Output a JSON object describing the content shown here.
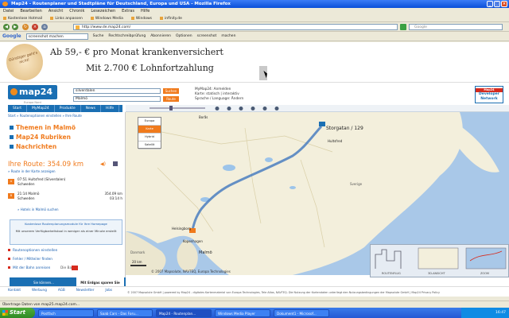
{
  "window": {
    "title": "Map24 - Routenplaner und Stadtpläne für Deutschland, Europa und USA - Mozilla Firefox"
  },
  "menu": [
    "Datei",
    "Bearbeiten",
    "Ansicht",
    "Chronik",
    "Lesezeichen",
    "Extras",
    "Hilfe"
  ],
  "bookmarks": [
    "Kostenlose Hotmail",
    "Links anpassen",
    "Windows Media",
    "Windows",
    "infinity.de"
  ],
  "nav": {
    "url": "http://www.de.map24.com/",
    "search_placeholder": "Google"
  },
  "google_toolbar": {
    "logo": "Google",
    "query": "screenshot machen",
    "items": [
      "Suche",
      "Rechtschreibprüfung",
      "Abonnieren",
      "Optionen",
      "screenshot",
      "machen"
    ]
  },
  "ad": {
    "stamp": "Günstiger geht's nicht!",
    "line1": "Ab 59,- € pro Monat krankenversichert",
    "line2": "Mit 2.700 € Lohnfortzahlung"
  },
  "header": {
    "logo": "map24",
    "logo_sub": "Europa Nord",
    "from": "silverdalen",
    "to": "Malmö",
    "route_btn": "Route",
    "search_btn": "Suchen",
    "links": [
      "MyMap24: Anmelden",
      "Karte: statisch | interaktiv",
      "Sprache / Language: Ändern"
    ],
    "devnet_top": "Map24",
    "devnet_mid": "Developer",
    "devnet_bot": "Network"
  },
  "tabs": [
    "Start",
    "MyMap24",
    "Produkte",
    "News",
    "Hilfe"
  ],
  "sidebar": {
    "breadcrumb": "Start » Routenoptionen einstellen » Ihre Route",
    "themes": [
      "Themen in Malmö",
      "Map24 Rubriken",
      "Nachrichten"
    ],
    "route_title": "Ihre Route: 354.09 km",
    "route_link": "» Route in der Karte anzeigen",
    "wp1_a": "07:51 Hultsfred (Silverdalen)",
    "wp1_b": "Schweden",
    "wp2_a": "21:14 Malmö",
    "wp2_b": "Schweden",
    "wp2_dist": "354.09 km",
    "wp2_time": "03:14 h",
    "hotels": "» Hotels in Malmö suchen",
    "promo_1": "Kostenlose Routenplanungsmodule für Ihre Homepage",
    "promo_2": "Mit unserem Verfügbarkeitstool in weniger als einer Minute erstellt",
    "opts": [
      "Routenoptionen einstellen",
      "Fehler / Mitteiler finden",
      "Mit der Bahn anreisen"
    ],
    "bahn": "Die Bahn",
    "bottom_ad_left": "Sie können...",
    "bottom_ad_right": "Mit Erdgas sparen Sie"
  },
  "map": {
    "modes": [
      "Europa",
      "Karte",
      "Hybrid",
      "Satellit"
    ],
    "active_mode": "Karte",
    "places": [
      "Storgatan / 129",
      "Hultsfred",
      "Borås",
      "Malmö",
      "Helsingborg",
      "Kopenhagen",
      "Danmark",
      "Sverige"
    ],
    "scale": "20 km",
    "copyright": "© 2007 Mapsolute, NAVTEQ, Europa Technologies",
    "legend_labels": [
      "ROUTENFLUG",
      "3D-ANSICHT",
      "ZOOM"
    ]
  },
  "footer": {
    "links": [
      "Kontakt",
      "Werbung",
      "AGB",
      "Newsletter",
      "Jobs"
    ],
    "copy": "© 2007 Mapsolute GmbH | powered by Map24 - digitales Kartenmaterial von Europa Technologies, Tele Atlas, NAVTEQ. Die Nutzung der Kartendaten unterliegt den Nutzungsbedingungen der Mapsolute GmbH | Map24 Privacy Policy"
  },
  "status": "Übertrage Daten von map25.map24.com...",
  "taskbar": {
    "start": "Start",
    "tasks": [
      "Postfach",
      "Saab Cars - Das Foru...",
      "Map24 - Routenplan...",
      "Windows Media Player",
      "Dokument1 - Microsof..."
    ],
    "active_index": 2,
    "clock": "16:47"
  }
}
